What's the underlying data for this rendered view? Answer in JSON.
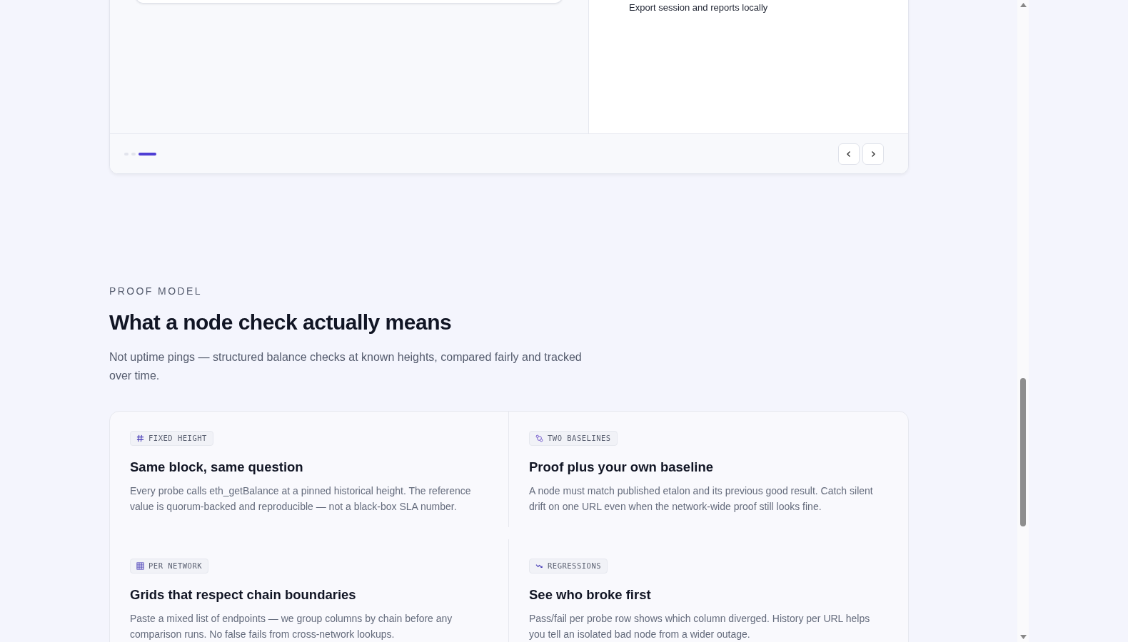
{
  "carousel": {
    "visible_text": "Export session and reports locally",
    "dots": [
      {
        "selected": false
      },
      {
        "selected": false
      },
      {
        "selected": true
      }
    ]
  },
  "section": {
    "eyebrow": "PROOF MODEL",
    "title": "What a node check actually means",
    "subtitle": "Not uptime pings — structured balance checks at known heights, compared fairly and tracked over time.",
    "features": [
      {
        "kind": "hash",
        "tag": "FIXED HEIGHT",
        "title": "Same block, same question",
        "text": "Every probe calls eth_getBalance at a pinned historical height. The reference value is quorum-backed and reproducible — not a black-box SLA number."
      },
      {
        "kind": "compare",
        "tag": "TWO BASELINES",
        "title": "Proof plus your own baseline",
        "text": "A node must match published etalon and its previous good result. Catch silent drift on one URL even when the network-wide proof still looks fine."
      },
      {
        "kind": "grid",
        "tag": "PER NETWORK",
        "title": "Grids that respect chain boundaries",
        "text": "Paste a mixed list of endpoints — we group columns by chain before any comparison runs. No false fails from cross-network lookups."
      },
      {
        "kind": "trend",
        "tag": "REGRESSIONS",
        "title": "See who broke first",
        "text": "Pass/fail per probe row shows which column diverged. History per URL helps you tell an isolated bad node from a wider outage."
      }
    ]
  }
}
